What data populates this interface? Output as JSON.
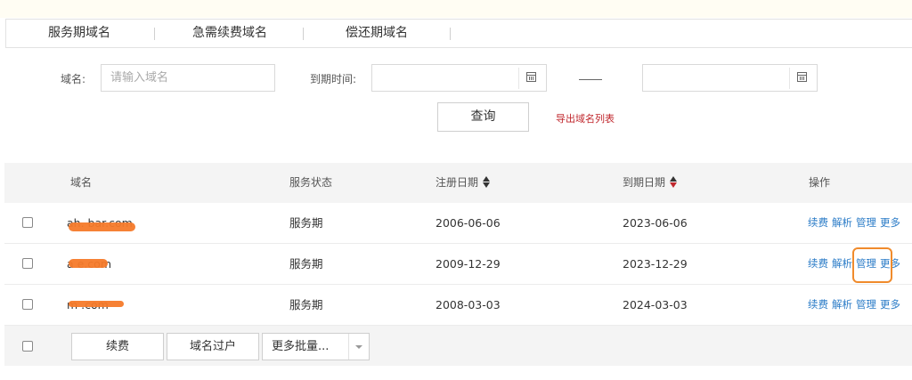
{
  "tabs": [
    {
      "label": "服务期域名"
    },
    {
      "label": "急需续费域名"
    },
    {
      "label": "偿还期域名"
    }
  ],
  "filters": {
    "domain_label": "域名:",
    "domain_placeholder": "请输入域名",
    "expiry_label": "到期时间:",
    "date_from": "",
    "date_to": ""
  },
  "actions": {
    "query_label": "查询",
    "export_label": "导出域名列表"
  },
  "table": {
    "headers": {
      "domain": "域名",
      "status": "服务状态",
      "reg_date": "注册日期",
      "exp_date": "到期日期",
      "ops": "操作"
    },
    "rows": [
      {
        "domain_visible": "ah.    bar.com",
        "status": "服务期",
        "reg_date": "2006-06-06",
        "exp_date": "2023-06-06"
      },
      {
        "domain_visible": "a      e.com",
        "status": "服务期",
        "reg_date": "2009-12-29",
        "exp_date": "2023-12-29"
      },
      {
        "domain_visible": "m      .com",
        "status": "服务期",
        "reg_date": "2008-03-03",
        "exp_date": "2024-03-03"
      }
    ],
    "row_actions": [
      "续费",
      "解析",
      "管理",
      "更多"
    ]
  },
  "footer": {
    "renew_label": "续费",
    "transfer_label": "域名过户",
    "more_batch_label": "更多批量..."
  },
  "colors": {
    "link": "#2a7bc7",
    "export": "#c0272d",
    "highlight": "#f08b2c",
    "redaction": "#f57a2a"
  }
}
